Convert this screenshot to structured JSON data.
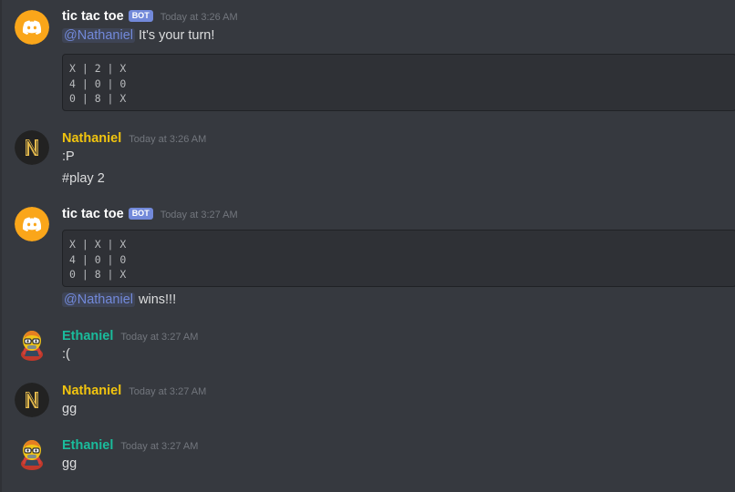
{
  "colors": {
    "background": "#36393f",
    "bot_name": "#ffffff",
    "nathaniel_name": "#f1c40f",
    "ethaniel_name": "#1abc9c",
    "mention": "#7289da",
    "timestamp": "#72767d",
    "text": "#dcddde"
  },
  "messages": [
    {
      "author": "tic tac toe",
      "bot_badge": "BOT",
      "timestamp": "Today at 3:26 AM",
      "avatar_icon": "discord-logo-icon",
      "mention": "@Nathaniel",
      "text": " It's your turn!",
      "code_lines": [
        "X | 2 | X",
        "4 | 0 | 0",
        "0 | 8 | X"
      ]
    },
    {
      "author": "Nathaniel",
      "timestamp": "Today at 3:26 AM",
      "avatar_icon": "n-monogram-icon",
      "lines": [
        ":P",
        "#play 2"
      ]
    },
    {
      "author": "tic tac toe",
      "bot_badge": "BOT",
      "timestamp": "Today at 3:27 AM",
      "avatar_icon": "discord-logo-icon",
      "code_lines": [
        "X | X | X",
        "4 | 0 | 0",
        "0 | 8 | X"
      ],
      "mention": "@Nathaniel",
      "text": " wins!!!"
    },
    {
      "author": "Ethaniel",
      "timestamp": "Today at 3:27 AM",
      "avatar_icon": "cartoon-character-icon",
      "text": ":("
    },
    {
      "author": "Nathaniel",
      "timestamp": "Today at 3:27 AM",
      "avatar_icon": "n-monogram-icon",
      "text": "gg"
    },
    {
      "author": "Ethaniel",
      "timestamp": "Today at 3:27 AM",
      "avatar_icon": "cartoon-character-icon",
      "text": "gg"
    }
  ]
}
